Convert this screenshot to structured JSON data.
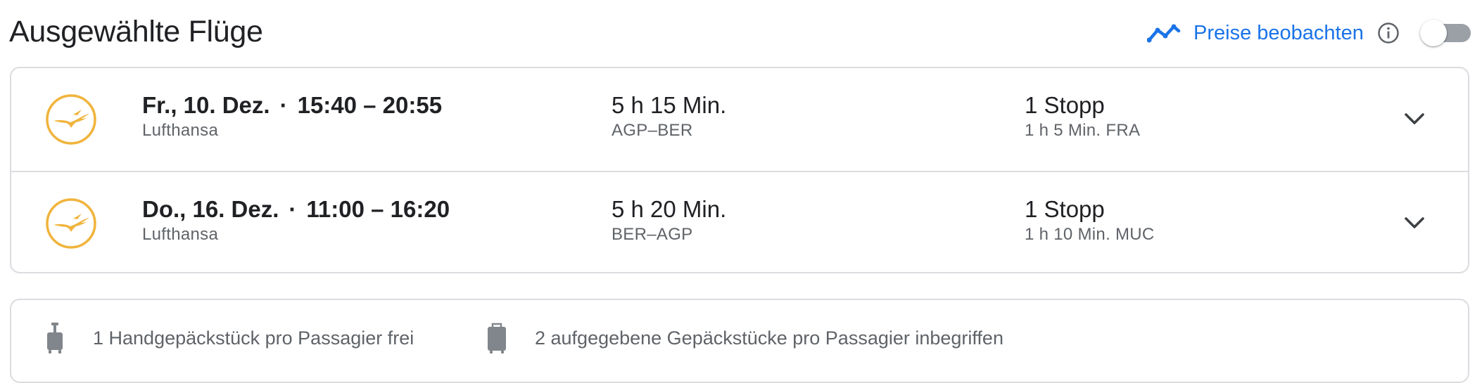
{
  "header": {
    "title": "Ausgewählte Flüge",
    "track_prices_label": "Preise beobachten",
    "track_icon": "trending-line-icon",
    "info_icon": "info-icon",
    "toggle_state": "off"
  },
  "flights": [
    {
      "date": "Fr., 10. Dez.",
      "separator": "·",
      "times": "15:40 – 20:55",
      "airline": "Lufthansa",
      "duration": "5 h 15 Min.",
      "route": "AGP–BER",
      "stops": "1 Stopp",
      "layover": "1 h 5 Min. FRA"
    },
    {
      "date": "Do., 16. Dez.",
      "separator": "·",
      "times": "11:00 – 16:20",
      "airline": "Lufthansa",
      "duration": "5 h 20 Min.",
      "route": "BER–AGP",
      "stops": "1 Stopp",
      "layover": "1 h 10 Min. MUC"
    }
  ],
  "baggage": {
    "carry_on": "1 Handgepäckstück pro Passagier frei",
    "checked": "2 aufgegebene Gepäckstücke pro Passagier inbegriffen"
  },
  "colors": {
    "accent": "#1a73e8",
    "text_primary": "#202124",
    "text_secondary": "#5f6368",
    "border": "#dadce0",
    "lufthansa_gold": "#f0b43c"
  }
}
